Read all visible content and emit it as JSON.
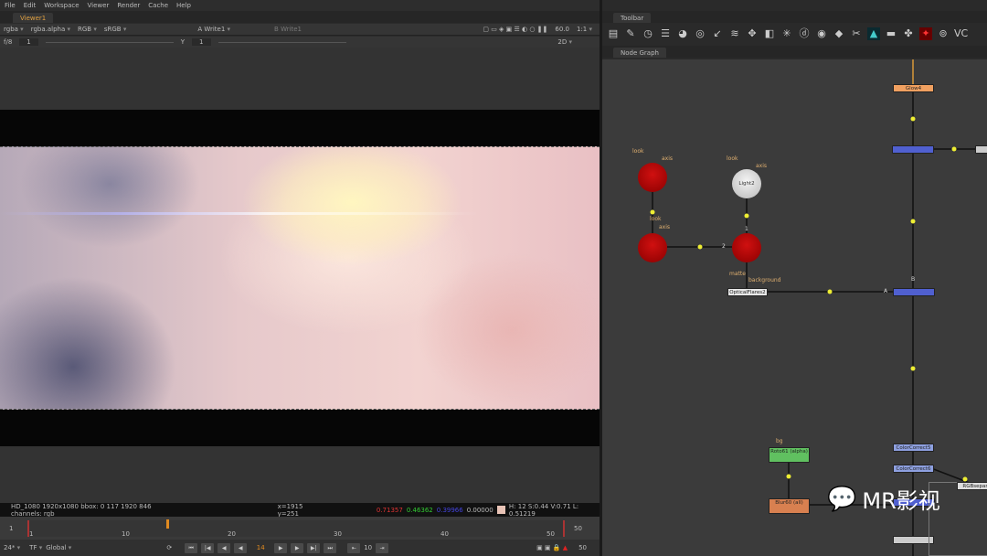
{
  "menu": [
    "File",
    "Edit",
    "Workspace",
    "Viewer",
    "Render",
    "Cache",
    "Help"
  ],
  "viewer": {
    "tab": "Viewer1",
    "channels": "rgba",
    "alpha": "rgba.alpha",
    "display": "RGB",
    "lut": "sRGB",
    "input_a": "A  Write1",
    "input_b": "B  Write1",
    "fps": "60.0",
    "zoom": "1:1",
    "gain": "f/8",
    "gain_val": "1",
    "gamma_label": "Y",
    "gamma_val": "1",
    "mode": "2D"
  },
  "info": {
    "format": "HD_1080 1920x1080  bbox: 0 117 1920 846 channels: rgb",
    "coords": "x=1915 y=251",
    "r": "0.71357",
    "g": "0.46362",
    "b": "0.39966",
    "a": "0.00000",
    "hsvl": "H: 12 S:0.44 V:0.71  L: 0.51219"
  },
  "timeline": {
    "start": "1",
    "end": "50",
    "current": "14",
    "ticks": [
      "1",
      "10",
      "20",
      "30",
      "40",
      "50"
    ],
    "fps": "24*",
    "tf": "TF",
    "scope": "Global",
    "step": "10",
    "end2": "50"
  },
  "right": {
    "toolbar_tab": "Toolbar",
    "graph_tab": "Node Graph",
    "vc": "VC"
  },
  "nodes": {
    "glow": "Glow4",
    "light2": "Light2",
    "optical": "OpticalFlares2",
    "roto": "Roto61 (alpha)",
    "blur": "Blur60 (all)",
    "cc5": "ColorCorrect5",
    "cc6": "ColorCorrect6",
    "rgbsep": "RGBsepar",
    "look": "look",
    "axis": "axis",
    "matte": "matte",
    "bg_in": "background",
    "bg": "bg",
    "a": "A",
    "b": "B",
    "one": "1",
    "two": "2"
  },
  "watermark": "MR影视"
}
